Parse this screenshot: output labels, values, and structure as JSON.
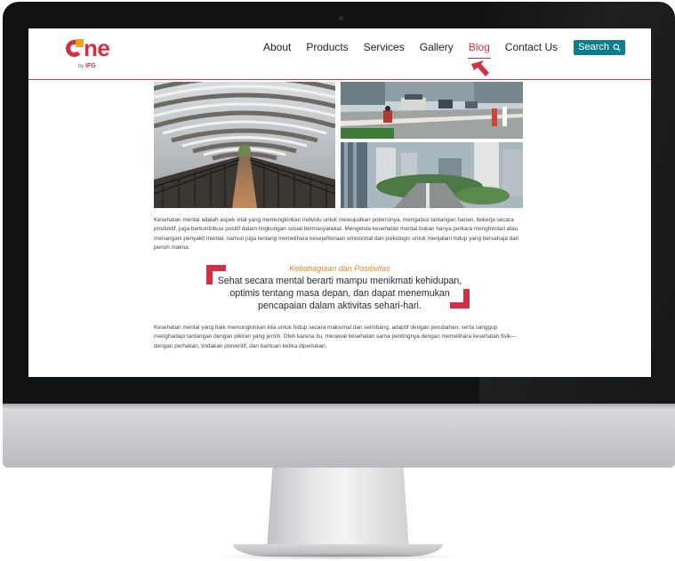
{
  "site": {
    "logo_text": "ne",
    "logo_by": "by",
    "logo_brand": "IFG"
  },
  "nav": {
    "items": [
      {
        "label": "About"
      },
      {
        "label": "Products"
      },
      {
        "label": "Services"
      },
      {
        "label": "Gallery"
      },
      {
        "label": "Blog",
        "active": true
      },
      {
        "label": "Contact Us"
      }
    ],
    "search_label": "Search"
  },
  "article": {
    "paragraph1": "Kesehatan mental adalah aspek vital yang memungkinkan individu untuk mewujudkan potensinya, mengatasi tantangan harian, bekerja secara produktif, juga berkontribusi positif dalam lingkungan sosial bermasyarakat. Mengelola kesehatan mental bukan hanya perkara menghindari atau menangani penyakit mental, namun juga tentang memelihara kesejahteraan emosional dan psikologis untuk menjalani hidup yang bersahaja dan penuh makna.",
    "quote_subtitle": "Kebahagiaan dan Positivitas",
    "quote": "Sehat secara mental berarti mampu menikmati kehidupan, optimis tentang masa depan, dan dapat menemukan pencapaian dalam aktivitas sehari-hari.",
    "paragraph2": "Kesehatan mental yang baik memungkinkan kita untuk hidup secara maksimal dan seimbang, adaptif dengan perubahan, serta sanggup menghadapi tantangan dengan pikiran yang jernih. Oleh karena itu, merawat kesehatan sama pentingnya dengan memelihara kesehatan fisik—dengan perhatian, tindakan preventif, dan bantuan ketika diperlukan."
  },
  "colors": {
    "brand_red": "#d23044",
    "brand_orange": "#e58a1a",
    "search_teal": "#0e7d8f"
  }
}
